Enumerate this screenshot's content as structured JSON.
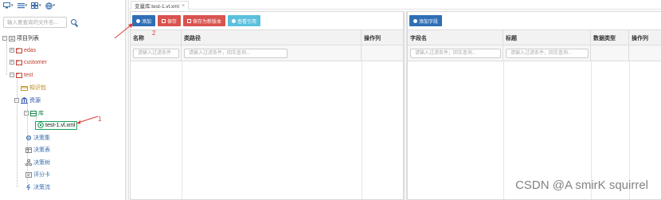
{
  "toolbar": {
    "items": [
      {
        "icon": "monitor-icon"
      },
      {
        "icon": "list-icon"
      },
      {
        "icon": "grid-icon"
      },
      {
        "icon": "globe-icon"
      }
    ]
  },
  "search": {
    "placeholder": "输入要查询的文件名..."
  },
  "tree": {
    "root": "项目列表",
    "items": [
      "edas",
      "customer",
      "test"
    ],
    "test_children": {
      "knowledge": "知识包",
      "resources": "资源",
      "lib": "库",
      "file": "test-1.vl.xml",
      "decision_set": "决策集",
      "decision_table": "决策表",
      "decision_tree": "决策树",
      "scorecard": "评分卡",
      "decision_flow": "决策流"
    }
  },
  "tab": {
    "label": "变量库:test-1.vl.xml",
    "close": "×"
  },
  "left_pane": {
    "buttons": {
      "add": "添加",
      "save": "保存",
      "save_new": "保存为新版本",
      "view_ref": "查看引用"
    },
    "headers": [
      "名称",
      "类路径",
      "操作列"
    ],
    "filters": {
      "name": "请输入过滤条件",
      "classpath": "请输入过滤条件，回车查询..."
    }
  },
  "right_pane": {
    "buttons": {
      "add_field": "添加字段"
    },
    "headers": [
      "字段名",
      "标题",
      "数据类型",
      "操作列"
    ],
    "filters": {
      "field": "请输入过滤条件，回车查询...",
      "title": "请输入过滤条件，回车查询..."
    }
  },
  "annotations": {
    "one": "1",
    "two": "2"
  },
  "watermark": "CSDN @A smirK squirrel",
  "colors": {
    "primary": "#2f6fb5",
    "danger": "#d9534f",
    "info": "#5bc0de",
    "selected_border": "#1aa260",
    "annotation": "#e03b3b"
  }
}
